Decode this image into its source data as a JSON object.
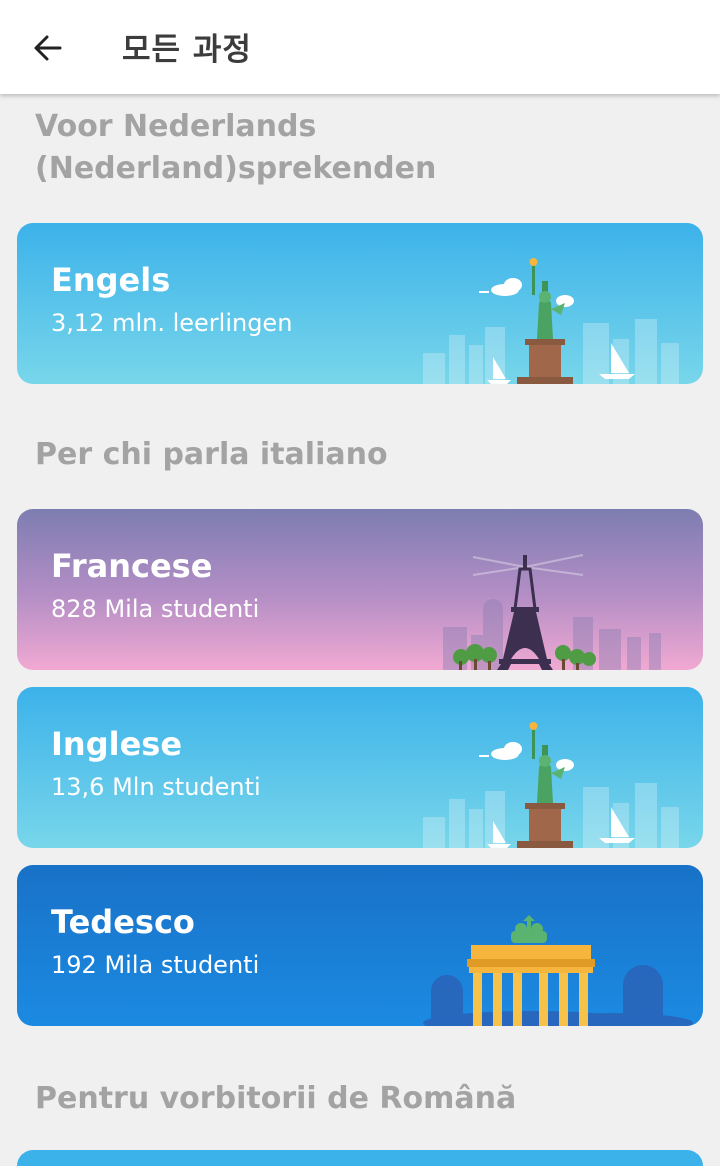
{
  "header": {
    "title": "모든 과정",
    "back_icon": "arrow-left-icon"
  },
  "sections": [
    {
      "header": "Voor Nederlands (Nederland)sprekenden",
      "courses": [
        {
          "name": "Engels",
          "learners": "3,12 mln. leerlingen",
          "icon": "statue-of-liberty-icon"
        }
      ]
    },
    {
      "header": "Per chi parla italiano",
      "courses": [
        {
          "name": "Francese",
          "learners": "828 Mila studenti",
          "icon": "eiffel-tower-icon"
        },
        {
          "name": "Inglese",
          "learners": "13,6 Mln studenti",
          "icon": "statue-of-liberty-icon"
        },
        {
          "name": "Tedesco",
          "learners": "192 Mila studenti",
          "icon": "brandenburg-gate-icon"
        }
      ]
    },
    {
      "header": "Pentru vorbitorii de Română",
      "courses": []
    }
  ],
  "colors": {
    "background": "#f0f0f0",
    "section_header": "#a3a3a3",
    "card_light_blue": "#3cb2ea",
    "card_purple": "#7d7db1",
    "card_dark_blue": "#1872c7"
  }
}
